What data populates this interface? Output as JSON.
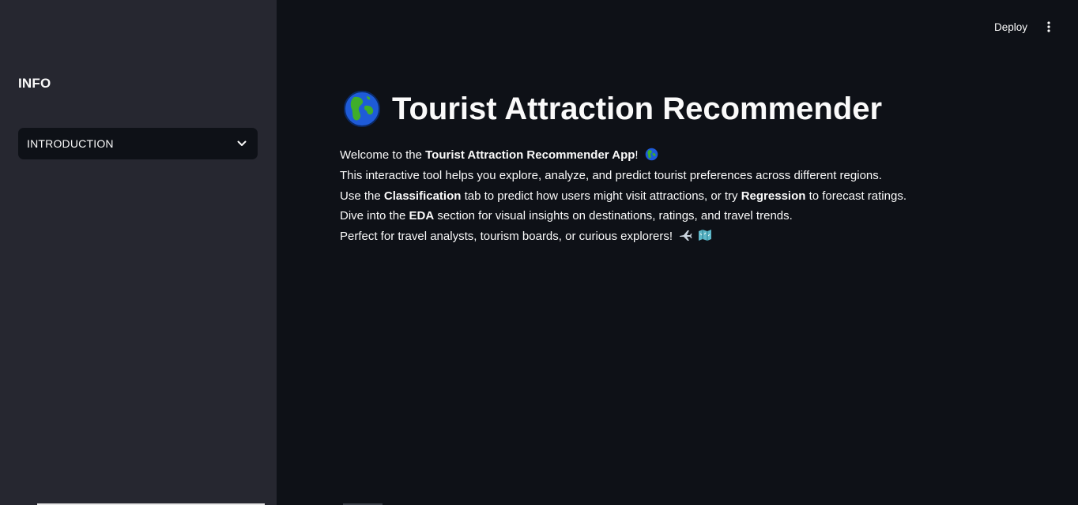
{
  "sidebar": {
    "heading": "INFO",
    "select": {
      "value": "INTRODUCTION"
    }
  },
  "header": {
    "deploy_label": "Deploy",
    "menu_icon": "kebab-menu-icon"
  },
  "main": {
    "title": "Tourist Attraction Recommender",
    "title_icon": "globe-icon",
    "lines": {
      "l1_a": "Welcome to the ",
      "l1_b": "Tourist Attraction Recommender App",
      "l1_c": "!",
      "l2": "This interactive tool helps you explore, analyze, and predict tourist preferences across different regions.",
      "l3_a": "Use the ",
      "l3_b": "Classification",
      "l3_c": " tab to predict how users might visit attractions, or try ",
      "l3_d": "Regression",
      "l3_e": " to forecast ratings.",
      "l4_a": "Dive into the ",
      "l4_b": "EDA",
      "l4_c": " section for visual insights on destinations, ratings, and travel trends.",
      "l5": "Perfect for travel analysts, tourism boards, or curious explorers!"
    }
  },
  "colors": {
    "background": "#0e1117",
    "sidebar": "#262730",
    "text": "#fafafa"
  }
}
